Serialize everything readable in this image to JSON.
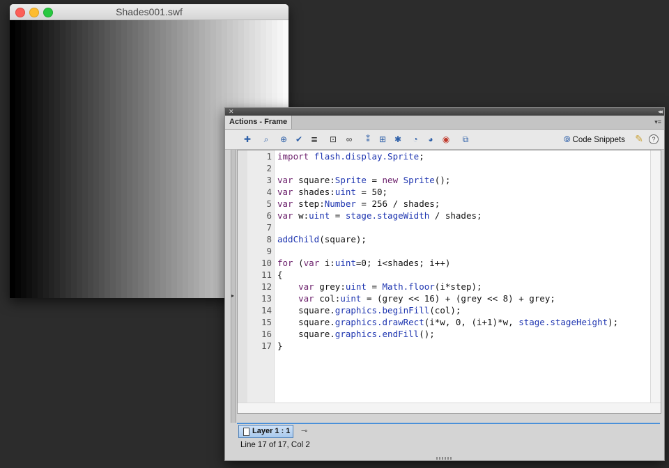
{
  "swf_window": {
    "title": "Shades001.swf",
    "shades": 50
  },
  "actions_panel": {
    "close_glyph": "✕",
    "collapse_glyph": "◂◂",
    "tab_label": "Actions - Frame",
    "menu_glyph": "▾≡",
    "toolbar": {
      "code_snippets_label": "Code Snippets",
      "help_glyph": "?"
    },
    "code_lines": [
      [
        {
          "t": "kw",
          "v": "import"
        },
        {
          "t": "",
          "v": " "
        },
        {
          "t": "ty",
          "v": "flash.display.Sprite"
        },
        {
          "t": "",
          "v": ";"
        }
      ],
      [],
      [
        {
          "t": "kw",
          "v": "var"
        },
        {
          "t": "",
          "v": " square:"
        },
        {
          "t": "ty",
          "v": "Sprite"
        },
        {
          "t": "",
          "v": " = "
        },
        {
          "t": "kw",
          "v": "new"
        },
        {
          "t": "",
          "v": " "
        },
        {
          "t": "ty",
          "v": "Sprite"
        },
        {
          "t": "",
          "v": "();"
        }
      ],
      [
        {
          "t": "kw",
          "v": "var"
        },
        {
          "t": "",
          "v": " shades:"
        },
        {
          "t": "ty",
          "v": "uint"
        },
        {
          "t": "",
          "v": " = 50;"
        }
      ],
      [
        {
          "t": "kw",
          "v": "var"
        },
        {
          "t": "",
          "v": " step:"
        },
        {
          "t": "ty",
          "v": "Number"
        },
        {
          "t": "",
          "v": " = 256 / shades;"
        }
      ],
      [
        {
          "t": "kw",
          "v": "var"
        },
        {
          "t": "",
          "v": " w:"
        },
        {
          "t": "ty",
          "v": "uint"
        },
        {
          "t": "",
          "v": " = "
        },
        {
          "t": "fn",
          "v": "stage.stageWidth"
        },
        {
          "t": "",
          "v": " / shades;"
        }
      ],
      [],
      [
        {
          "t": "fn",
          "v": "addChild"
        },
        {
          "t": "",
          "v": "(square);"
        }
      ],
      [],
      [
        {
          "t": "kw",
          "v": "for"
        },
        {
          "t": "",
          "v": " ("
        },
        {
          "t": "kw",
          "v": "var"
        },
        {
          "t": "",
          "v": " i:"
        },
        {
          "t": "ty",
          "v": "uint"
        },
        {
          "t": "",
          "v": "=0; i<shades; i++)"
        }
      ],
      [
        {
          "t": "",
          "v": "{"
        }
      ],
      [
        {
          "t": "",
          "v": "    "
        },
        {
          "t": "kw",
          "v": "var"
        },
        {
          "t": "",
          "v": " grey:"
        },
        {
          "t": "ty",
          "v": "uint"
        },
        {
          "t": "",
          "v": " = "
        },
        {
          "t": "fn",
          "v": "Math.floor"
        },
        {
          "t": "",
          "v": "(i*step);"
        }
      ],
      [
        {
          "t": "",
          "v": "    "
        },
        {
          "t": "kw",
          "v": "var"
        },
        {
          "t": "",
          "v": " col:"
        },
        {
          "t": "ty",
          "v": "uint"
        },
        {
          "t": "",
          "v": " = (grey << 16) + (grey << 8) + grey;"
        }
      ],
      [
        {
          "t": "",
          "v": "    square."
        },
        {
          "t": "fn",
          "v": "graphics.beginFill"
        },
        {
          "t": "",
          "v": "(col);"
        }
      ],
      [
        {
          "t": "",
          "v": "    square."
        },
        {
          "t": "fn",
          "v": "graphics.drawRect"
        },
        {
          "t": "",
          "v": "(i*w, 0, (i+1)*w, "
        },
        {
          "t": "fn",
          "v": "stage.stageHeight"
        },
        {
          "t": "",
          "v": ");"
        }
      ],
      [
        {
          "t": "",
          "v": "    square."
        },
        {
          "t": "fn",
          "v": "graphics.endFill"
        },
        {
          "t": "",
          "v": "();"
        }
      ],
      [
        {
          "t": "",
          "v": "}"
        }
      ]
    ],
    "layer_tab_label": "Layer 1 : 1",
    "status": "Line 17 of 17, Col 2"
  }
}
